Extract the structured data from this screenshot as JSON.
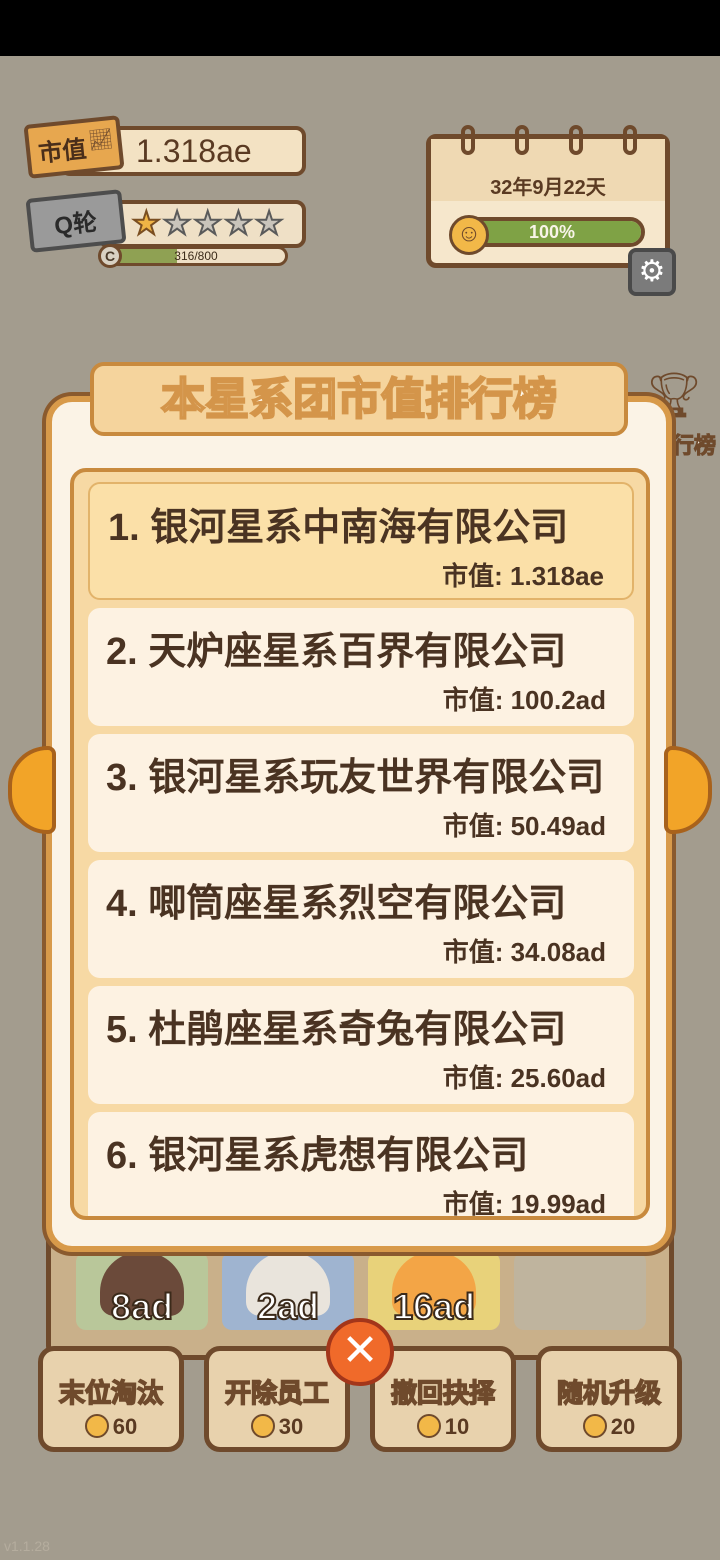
{
  "hud": {
    "market_value_badge": "市值",
    "market_value": "1.318ae",
    "round_badge": "Q轮",
    "stars_filled": 1,
    "stars_total": 5,
    "xp_text": "316/800",
    "xp_coin_label": "C",
    "date": "32年9月22天",
    "mood_percent": "100%"
  },
  "side": {
    "ranking_label": "行榜"
  },
  "modal": {
    "title": "本星系团市值排行榜",
    "entries": [
      {
        "name": "1. 银河星系中南海有限公司",
        "value": "市值: 1.318ae"
      },
      {
        "name": "2. 天炉座星系百界有限公司",
        "value": "市值: 100.2ad"
      },
      {
        "name": "3. 银河星系玩友世界有限公司",
        "value": "市值: 50.49ad"
      },
      {
        "name": "4. 唧筒座星系烈空有限公司",
        "value": "市值: 34.08ad"
      },
      {
        "name": "5. 杜鹃座星系奇兔有限公司",
        "value": "市值: 25.60ad"
      },
      {
        "name": "6. 银河星系虎想有限公司",
        "value": "市值: 19.99ad"
      }
    ]
  },
  "staff": [
    {
      "price": "8ad"
    },
    {
      "price": "2ad"
    },
    {
      "price": "16ad"
    }
  ],
  "actions": [
    {
      "label": "末位淘汰",
      "cost": "60"
    },
    {
      "label": "开除员工",
      "cost": "30"
    },
    {
      "label": "撤回抉择",
      "cost": "10"
    },
    {
      "label": "随机升级",
      "cost": "20"
    }
  ],
  "version": "v1.1.28",
  "colors": {
    "accent": "#f2a428",
    "brown": "#6f4a2c",
    "background": "#a39c8e"
  }
}
